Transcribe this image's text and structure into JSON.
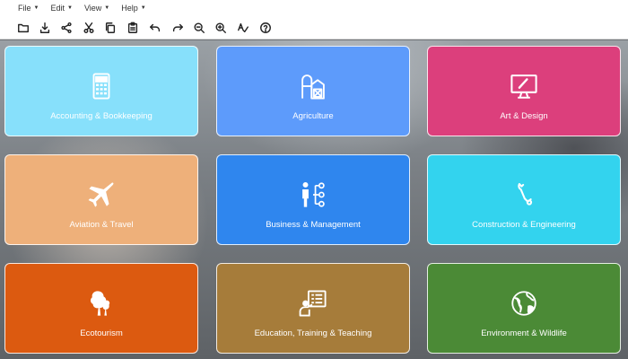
{
  "menubar": {
    "items": [
      "File",
      "Edit",
      "View",
      "Help"
    ]
  },
  "toolbar": {
    "tools": [
      "open-folder",
      "download",
      "share",
      "cut",
      "copy",
      "paste",
      "undo",
      "redo",
      "zoom-out",
      "zoom-in",
      "spell-check",
      "help"
    ]
  },
  "cards": [
    {
      "label": "Accounting & Bookkeeping",
      "color": "#87e0fb",
      "icon": "calculator-icon"
    },
    {
      "label": "Agriculture",
      "color": "#5d9bfb",
      "icon": "barn-icon"
    },
    {
      "label": "Art & Design",
      "color": "#dc3f7c",
      "icon": "monitor-icon"
    },
    {
      "label": "Aviation & Travel",
      "color": "#eeb07a",
      "icon": "airplane-icon"
    },
    {
      "label": "Business & Management",
      "color": "#2f86ee",
      "icon": "org-chart-icon"
    },
    {
      "label": "Construction & Engineering",
      "color": "#33d3ee",
      "icon": "wrench-icon"
    },
    {
      "label": "Ecotourism",
      "color": "#dc5a10",
      "icon": "trees-icon"
    },
    {
      "label": "Education, Training & Teaching",
      "color": "#a67c3a",
      "icon": "teacher-board-icon"
    },
    {
      "label": "Environment & Wildlife",
      "color": "#4b8a36",
      "icon": "globe-icon"
    }
  ]
}
